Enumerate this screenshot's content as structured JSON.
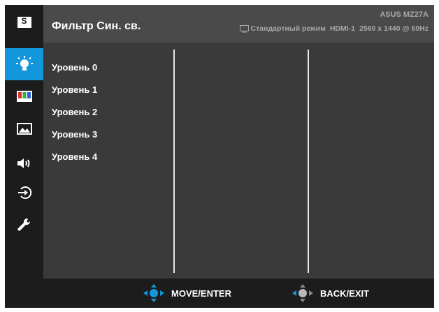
{
  "header": {
    "title": "Фильтр Син. св.",
    "model": "ASUS MZ27A",
    "mode": "Стандартный режим",
    "input": "HDMI-1",
    "resolution": "2560 x 1440 @ 60Hz"
  },
  "sidebar": {
    "items": [
      {
        "icon": "splendid-icon",
        "label": "S",
        "active": false
      },
      {
        "icon": "blue-light-filter-icon",
        "active": true
      },
      {
        "icon": "color-icon",
        "active": false
      },
      {
        "icon": "image-icon",
        "active": false
      },
      {
        "icon": "sound-icon",
        "active": false
      },
      {
        "icon": "input-select-icon",
        "active": false
      },
      {
        "icon": "system-setup-icon",
        "active": false
      }
    ]
  },
  "options": [
    "Уровень 0",
    "Уровень 1",
    "Уровень 2",
    "Уровень 3",
    "Уровень 4"
  ],
  "footer": {
    "move_label": "MOVE/ENTER",
    "back_label": "BACK/EXIT"
  },
  "colors": {
    "accent": "#1296dc",
    "sidebar_bg": "#1c1c1c",
    "header_bg": "#4a4a4a",
    "content_bg": "#3a3a3a"
  }
}
